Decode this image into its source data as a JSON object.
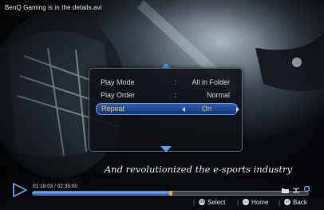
{
  "window": {
    "title": "BenQ Gaming is in the details.avi"
  },
  "subtitle_caption": "And revolutionized the e-sports industry",
  "menu": {
    "items": [
      {
        "label": "Play Mode",
        "value": "All in Folder"
      },
      {
        "label": "Play Order",
        "value": "Normal"
      },
      {
        "label": "Repeat",
        "value": "On",
        "selected": true
      }
    ],
    "separator": ":"
  },
  "player": {
    "time": "01:18:03 / 02:35:00",
    "progress": 0.5,
    "icons": [
      "folder-icon",
      "shuffle-icon",
      "repeat-icon"
    ]
  },
  "hints": [
    {
      "icon": "ok-button-icon",
      "label": "Select"
    },
    {
      "icon": "home-button-icon",
      "label": "Home"
    },
    {
      "icon": "back-button-icon",
      "label": "Back"
    }
  ],
  "colors": {
    "accent": "#5aa0e6",
    "highlight_text": "#f5c64a",
    "selection": "#2e5fb0"
  }
}
